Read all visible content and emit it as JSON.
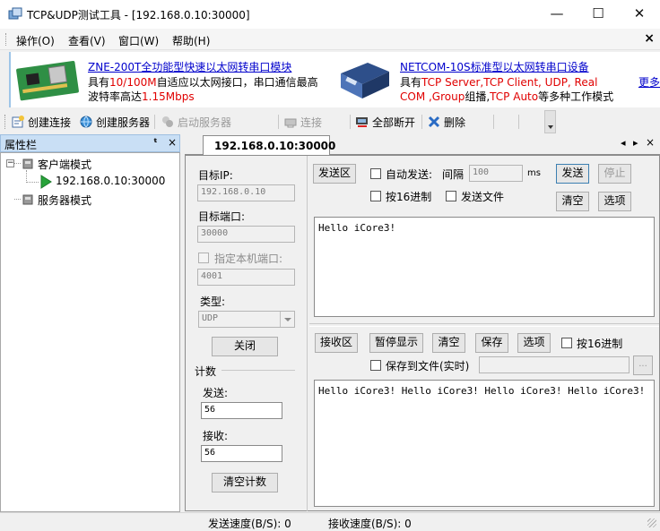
{
  "window": {
    "title": "TCP&UDP测试工具 - [192.168.0.10:30000]",
    "minimize": "—",
    "maximize": "☐",
    "close": "✕"
  },
  "menu": {
    "items": [
      "操作(O)",
      "查看(V)",
      "窗口(W)",
      "帮助(H)"
    ],
    "close": "×"
  },
  "banner": {
    "ad1_title": "ZNE-200T全功能型快速以太网转串口模块",
    "ad1_line1_pre": "具有",
    "ad1_line1_red": "10/100M",
    "ad1_line1_post": "自适应以太网接口，串口通信最高",
    "ad1_line2_pre": "波特率高达",
    "ad1_line2_red": "1.15Mbps",
    "ad2_title": "NETCOM-10S标准型以太网转串口设备",
    "ad2_line1_pre": "具有",
    "ad2_line1_red": "TCP Server,TCP Client, UDP, Real",
    "ad2_line2_red1": "COM ,Group",
    "ad2_line2_mid": "组播,",
    "ad2_line2_red2": "TCP Auto",
    "ad2_line2_post": "等多种工作模式",
    "more": "更多"
  },
  "toolbar": {
    "create_connection": "创建连接",
    "create_server": "创建服务器",
    "start_server": "启动服务器",
    "connect": "连接",
    "disconnect_all": "全部断开",
    "delete": "删除"
  },
  "sidebar": {
    "title": "属性栏",
    "pin": "ᵖ",
    "close": "×",
    "tree": {
      "client_mode": "客户端模式",
      "connection": "192.168.0.10:30000",
      "server_mode": "服务器模式"
    }
  },
  "tab": {
    "label": "192.168.0.10:30000",
    "nav_prev": "◂",
    "nav_next": "▸",
    "close": "×"
  },
  "config": {
    "target_ip_label": "目标IP:",
    "target_ip": "192.168.0.10",
    "target_port_label": "目标端口:",
    "target_port": "30000",
    "local_port_label": "指定本机端口:",
    "local_port": "4001",
    "type_label": "类型:",
    "type_value": "UDP",
    "close_button": "关闭",
    "counter_title": "计数",
    "sent_label": "发送:",
    "sent_value": "56",
    "recv_label": "接收:",
    "recv_value": "56",
    "clear_count": "清空计数"
  },
  "send": {
    "area_label": "发送区",
    "auto_send": "自动发送:",
    "interval_label": "间隔",
    "interval_value": "100",
    "interval_unit": "ms",
    "send_button": "发送",
    "stop_button": "停止",
    "hex_send": "按16进制",
    "send_file": "发送文件",
    "clear_button": "清空",
    "options_button": "选项",
    "text": "Hello iCore3!"
  },
  "receive": {
    "area_label": "接收区",
    "pause_button": "暂停显示",
    "clear_button": "清空",
    "save_button": "保存",
    "options_button": "选项",
    "hex_display": "按16进制",
    "save_to_file": "保存到文件(实时)",
    "browse_button": "...",
    "text": "Hello iCore3! Hello iCore3! Hello iCore3! Hello iCore3!"
  },
  "status": {
    "send_speed": "发送速度(B/S): 0",
    "recv_speed": "接收速度(B/S): 0"
  },
  "colors": {
    "accent_red": "#e00000",
    "link_blue": "#0000cc",
    "panel_header": "#c9dff5"
  }
}
